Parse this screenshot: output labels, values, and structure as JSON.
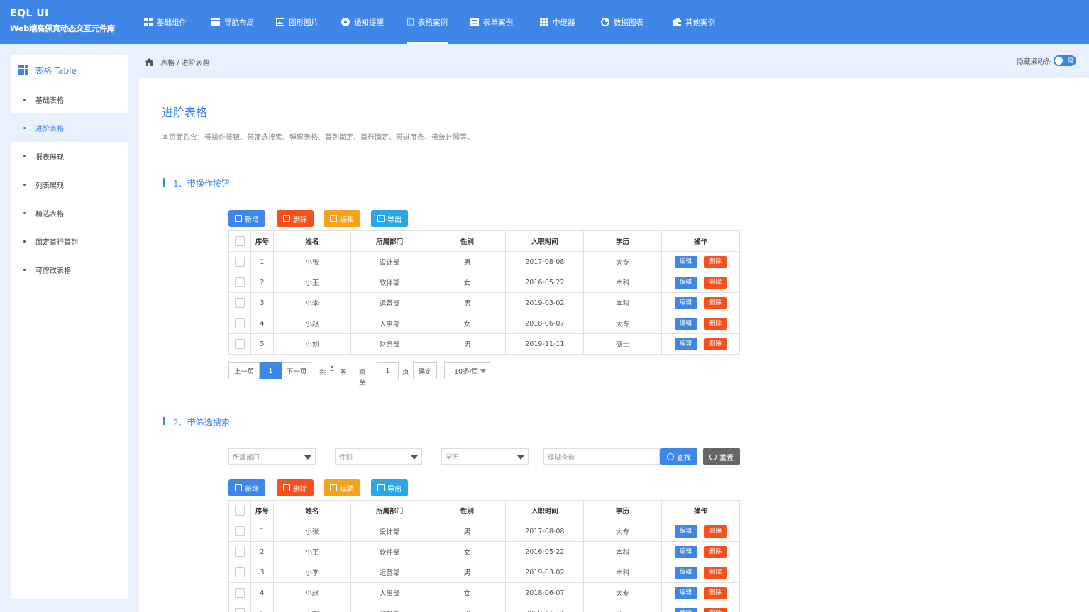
{
  "brand": {
    "name": "EQL UI",
    "subtitle": "Web端高保真动态交互元件库"
  },
  "nav": [
    {
      "label": "基础组件",
      "icon": "grid-icon"
    },
    {
      "label": "导航布局",
      "icon": "layout-icon"
    },
    {
      "label": "图形图片",
      "icon": "image-icon"
    },
    {
      "label": "通知提醒",
      "icon": "bell-icon"
    },
    {
      "label": "表格案例",
      "icon": "table-icon",
      "active": true
    },
    {
      "label": "表单案例",
      "icon": "form-icon"
    },
    {
      "label": "中继器",
      "icon": "repeater-icon"
    },
    {
      "label": "数据图表",
      "icon": "chart-icon"
    },
    {
      "label": "其他案例",
      "icon": "wallet-icon"
    }
  ],
  "sidebar": {
    "header": "表格 Table",
    "items": [
      "基础表格",
      "进阶表格",
      "报表展现",
      "列表展现",
      "精选表格",
      "固定首行首列",
      "可修改表格"
    ],
    "active_index": 1
  },
  "breadcrumb": "表格 / 进阶表格",
  "toggle": {
    "label": "隐藏滚动条",
    "state": "是"
  },
  "page": {
    "title": "进阶表格",
    "desc": "本页面包含：带操作按钮、带筛选搜索、弹窗表格、首列固定、首行固定、带进度条、带统计图等。"
  },
  "section1": {
    "title": "1、带操作按钮"
  },
  "section2": {
    "title": "2、带筛选搜索"
  },
  "buttons": {
    "add": "新增",
    "delete": "删除",
    "edit": "编辑",
    "export": "导出"
  },
  "table": {
    "headers": [
      "序号",
      "姓名",
      "所属部门",
      "性别",
      "入职时间",
      "学历",
      "操作"
    ],
    "rows": [
      [
        "1",
        "小张",
        "设计部",
        "男",
        "2017-08-08",
        "大专"
      ],
      [
        "2",
        "小王",
        "软件部",
        "女",
        "2016-05-22",
        "本科"
      ],
      [
        "3",
        "小李",
        "运营部",
        "男",
        "2019-03-02",
        "本科"
      ],
      [
        "4",
        "小赵",
        "人事部",
        "女",
        "2018-06-07",
        "大专"
      ],
      [
        "5",
        "小刘",
        "财务部",
        "男",
        "2019-11-11",
        "硕士"
      ]
    ],
    "row_edit": "编辑",
    "row_delete": "删除"
  },
  "pager": {
    "prev": "上一页",
    "current": "1",
    "next": "下一页",
    "total_prefix": "共",
    "total": "5",
    "total_suffix": "条",
    "jump_prefix": "跳至",
    "jump_value": "1",
    "jump_suffix": "页",
    "confirm": "确定",
    "page_size": "10条/页"
  },
  "filter": {
    "dept_placeholder": "所属部门",
    "gender_placeholder": "性别",
    "edu_placeholder": "学历",
    "search_placeholder": "模糊查询",
    "search_btn": "查找",
    "reset_btn": "重置"
  },
  "colors": {
    "primary": "#3f86e6",
    "danger": "#f4511e",
    "warning": "#f9a11b",
    "info": "#2aa7e8"
  }
}
